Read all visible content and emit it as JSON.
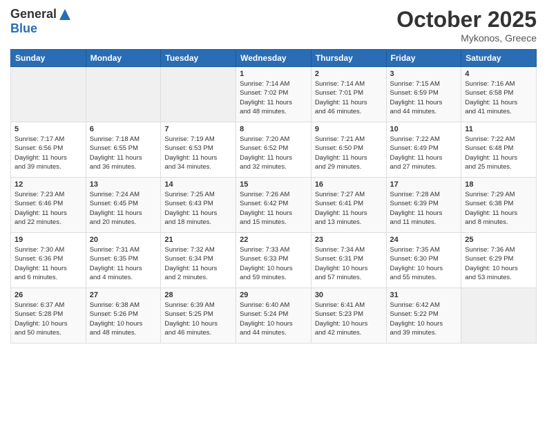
{
  "logo": {
    "general": "General",
    "blue": "Blue"
  },
  "header": {
    "month": "October 2025",
    "location": "Mykonos, Greece"
  },
  "weekdays": [
    "Sunday",
    "Monday",
    "Tuesday",
    "Wednesday",
    "Thursday",
    "Friday",
    "Saturday"
  ],
  "weeks": [
    [
      {
        "day": "",
        "info": ""
      },
      {
        "day": "",
        "info": ""
      },
      {
        "day": "",
        "info": ""
      },
      {
        "day": "1",
        "info": "Sunrise: 7:14 AM\nSunset: 7:02 PM\nDaylight: 11 hours\nand 48 minutes."
      },
      {
        "day": "2",
        "info": "Sunrise: 7:14 AM\nSunset: 7:01 PM\nDaylight: 11 hours\nand 46 minutes."
      },
      {
        "day": "3",
        "info": "Sunrise: 7:15 AM\nSunset: 6:59 PM\nDaylight: 11 hours\nand 44 minutes."
      },
      {
        "day": "4",
        "info": "Sunrise: 7:16 AM\nSunset: 6:58 PM\nDaylight: 11 hours\nand 41 minutes."
      }
    ],
    [
      {
        "day": "5",
        "info": "Sunrise: 7:17 AM\nSunset: 6:56 PM\nDaylight: 11 hours\nand 39 minutes."
      },
      {
        "day": "6",
        "info": "Sunrise: 7:18 AM\nSunset: 6:55 PM\nDaylight: 11 hours\nand 36 minutes."
      },
      {
        "day": "7",
        "info": "Sunrise: 7:19 AM\nSunset: 6:53 PM\nDaylight: 11 hours\nand 34 minutes."
      },
      {
        "day": "8",
        "info": "Sunrise: 7:20 AM\nSunset: 6:52 PM\nDaylight: 11 hours\nand 32 minutes."
      },
      {
        "day": "9",
        "info": "Sunrise: 7:21 AM\nSunset: 6:50 PM\nDaylight: 11 hours\nand 29 minutes."
      },
      {
        "day": "10",
        "info": "Sunrise: 7:22 AM\nSunset: 6:49 PM\nDaylight: 11 hours\nand 27 minutes."
      },
      {
        "day": "11",
        "info": "Sunrise: 7:22 AM\nSunset: 6:48 PM\nDaylight: 11 hours\nand 25 minutes."
      }
    ],
    [
      {
        "day": "12",
        "info": "Sunrise: 7:23 AM\nSunset: 6:46 PM\nDaylight: 11 hours\nand 22 minutes."
      },
      {
        "day": "13",
        "info": "Sunrise: 7:24 AM\nSunset: 6:45 PM\nDaylight: 11 hours\nand 20 minutes."
      },
      {
        "day": "14",
        "info": "Sunrise: 7:25 AM\nSunset: 6:43 PM\nDaylight: 11 hours\nand 18 minutes."
      },
      {
        "day": "15",
        "info": "Sunrise: 7:26 AM\nSunset: 6:42 PM\nDaylight: 11 hours\nand 15 minutes."
      },
      {
        "day": "16",
        "info": "Sunrise: 7:27 AM\nSunset: 6:41 PM\nDaylight: 11 hours\nand 13 minutes."
      },
      {
        "day": "17",
        "info": "Sunrise: 7:28 AM\nSunset: 6:39 PM\nDaylight: 11 hours\nand 11 minutes."
      },
      {
        "day": "18",
        "info": "Sunrise: 7:29 AM\nSunset: 6:38 PM\nDaylight: 11 hours\nand 8 minutes."
      }
    ],
    [
      {
        "day": "19",
        "info": "Sunrise: 7:30 AM\nSunset: 6:36 PM\nDaylight: 11 hours\nand 6 minutes."
      },
      {
        "day": "20",
        "info": "Sunrise: 7:31 AM\nSunset: 6:35 PM\nDaylight: 11 hours\nand 4 minutes."
      },
      {
        "day": "21",
        "info": "Sunrise: 7:32 AM\nSunset: 6:34 PM\nDaylight: 11 hours\nand 2 minutes."
      },
      {
        "day": "22",
        "info": "Sunrise: 7:33 AM\nSunset: 6:33 PM\nDaylight: 10 hours\nand 59 minutes."
      },
      {
        "day": "23",
        "info": "Sunrise: 7:34 AM\nSunset: 6:31 PM\nDaylight: 10 hours\nand 57 minutes."
      },
      {
        "day": "24",
        "info": "Sunrise: 7:35 AM\nSunset: 6:30 PM\nDaylight: 10 hours\nand 55 minutes."
      },
      {
        "day": "25",
        "info": "Sunrise: 7:36 AM\nSunset: 6:29 PM\nDaylight: 10 hours\nand 53 minutes."
      }
    ],
    [
      {
        "day": "26",
        "info": "Sunrise: 6:37 AM\nSunset: 5:28 PM\nDaylight: 10 hours\nand 50 minutes."
      },
      {
        "day": "27",
        "info": "Sunrise: 6:38 AM\nSunset: 5:26 PM\nDaylight: 10 hours\nand 48 minutes."
      },
      {
        "day": "28",
        "info": "Sunrise: 6:39 AM\nSunset: 5:25 PM\nDaylight: 10 hours\nand 46 minutes."
      },
      {
        "day": "29",
        "info": "Sunrise: 6:40 AM\nSunset: 5:24 PM\nDaylight: 10 hours\nand 44 minutes."
      },
      {
        "day": "30",
        "info": "Sunrise: 6:41 AM\nSunset: 5:23 PM\nDaylight: 10 hours\nand 42 minutes."
      },
      {
        "day": "31",
        "info": "Sunrise: 6:42 AM\nSunset: 5:22 PM\nDaylight: 10 hours\nand 39 minutes."
      },
      {
        "day": "",
        "info": ""
      }
    ]
  ]
}
